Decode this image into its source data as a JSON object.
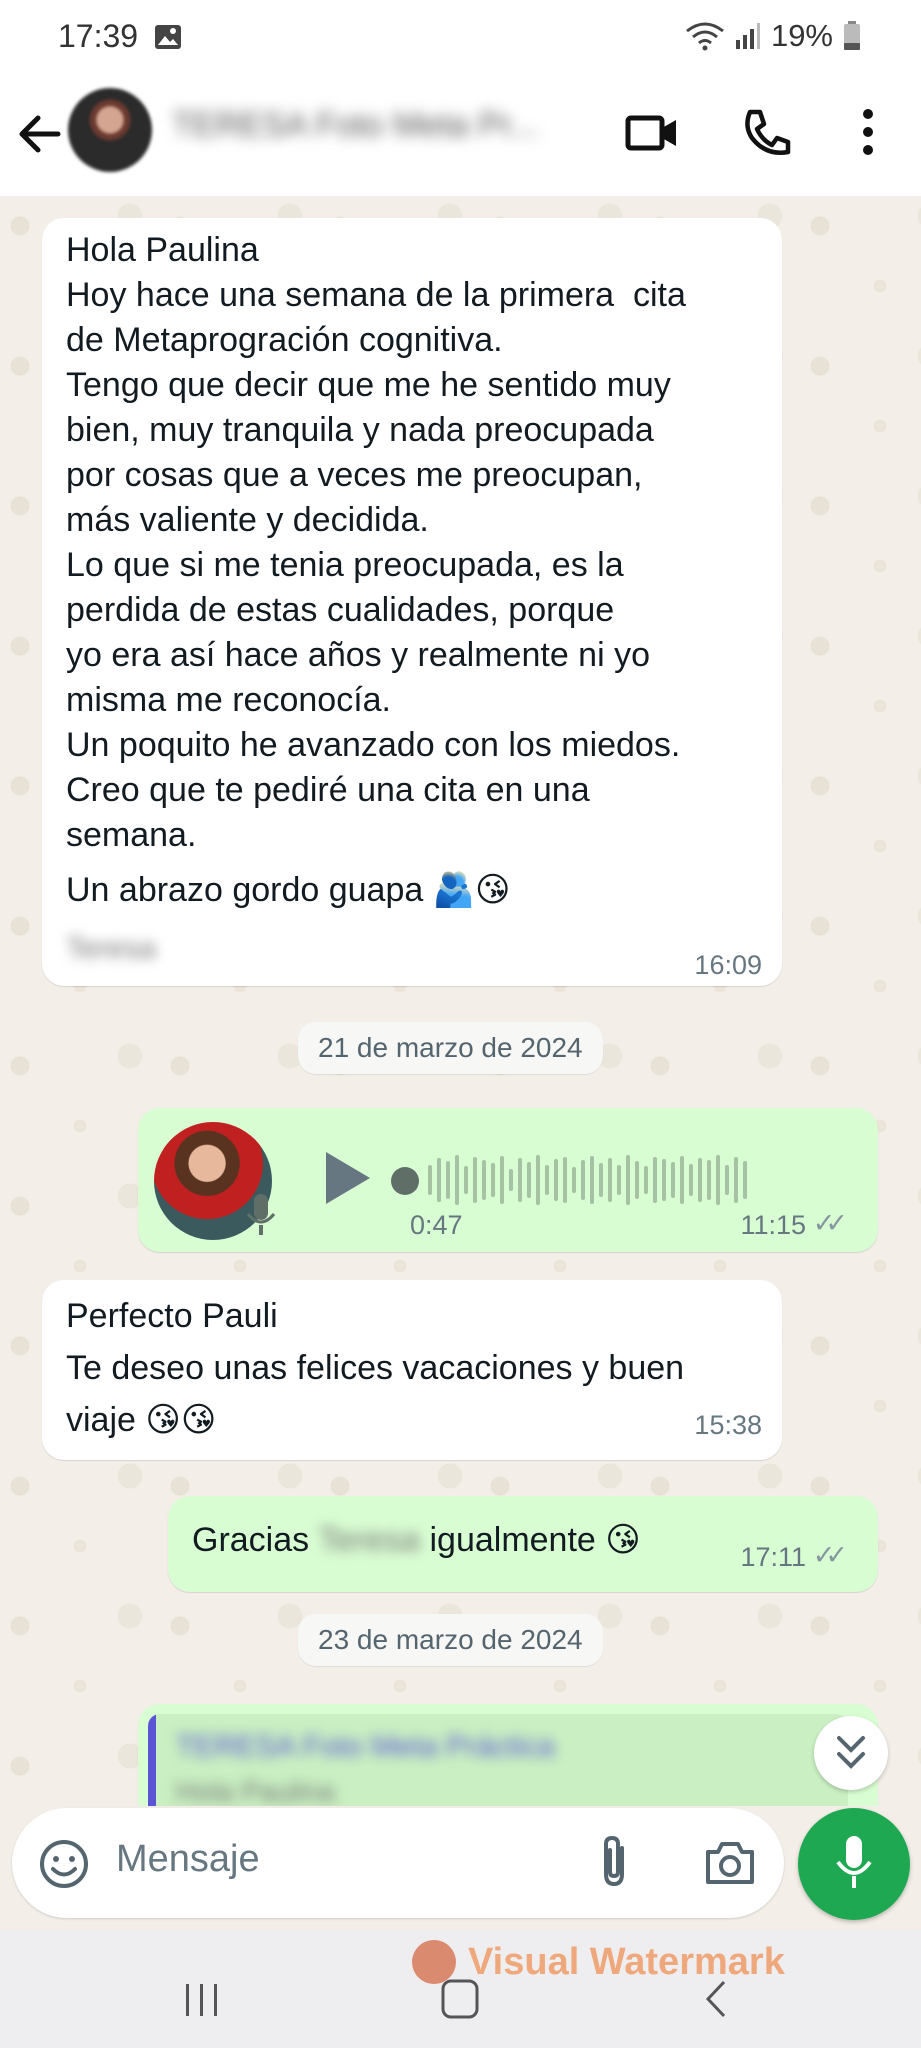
{
  "status_bar": {
    "time": "17:39",
    "battery": "19%",
    "icons": [
      "gallery-icon",
      "wifi-icon",
      "signal-icon",
      "battery-icon"
    ]
  },
  "header": {
    "contact_name": "TERESA Foto Meta Pr...",
    "icons": [
      "back-arrow-icon",
      "video-call-icon",
      "phone-icon",
      "more-options-icon"
    ]
  },
  "messages": [
    {
      "type": "text",
      "direction": "incoming",
      "text": "Hola Paulina\nHoy hace una semana de la primera  cita\nde Metaprogración cognitiva.\nTengo que decir que me he sentido muy\nbien, muy tranquila y nada preocupada\npor cosas que a veces me preocupan,\nmás valiente y decidida.\nLo que si me tenia preocupada, es la\nperdida de estas cualidades, porque\nyo era así hace años y realmente ni yo\nmisma me reconocía.\nUn poquito he avanzado con los miedos.\nCreo que te pediré una cita en una\nsemana.",
      "closing": "Un abrazo gordo guapa 🫂😘",
      "signature": "Teresa",
      "time": "16:09"
    },
    {
      "type": "date",
      "text": "21 de marzo de 2024"
    },
    {
      "type": "voice",
      "direction": "outgoing",
      "duration": "0:47",
      "time": "11:15",
      "ticks": "✓✓"
    },
    {
      "type": "text",
      "direction": "incoming",
      "text": "Perfecto Pauli\nTe deseo unas felices vacaciones y buen\nviaje 😘😘",
      "time": "15:38"
    },
    {
      "type": "text",
      "direction": "outgoing",
      "prefix": "Gracias ",
      "name": "Teresa",
      "suffix": " igualmente 😘",
      "time": "17:11",
      "ticks": "✓✓"
    },
    {
      "type": "date",
      "text": "23 de marzo de 2024"
    },
    {
      "type": "reply",
      "direction": "outgoing",
      "quoted_name": "TERESA Foto Meta Práctica",
      "quoted_text": "Hola Paulina"
    }
  ],
  "input": {
    "placeholder": "Mensaje"
  },
  "watermark": "Visual Watermark",
  "colors": {
    "outgoing_bubble": "#d9fdd3",
    "incoming_bubble": "#ffffff",
    "accent_green": "#1da851",
    "chat_background": "#f3efe8"
  }
}
